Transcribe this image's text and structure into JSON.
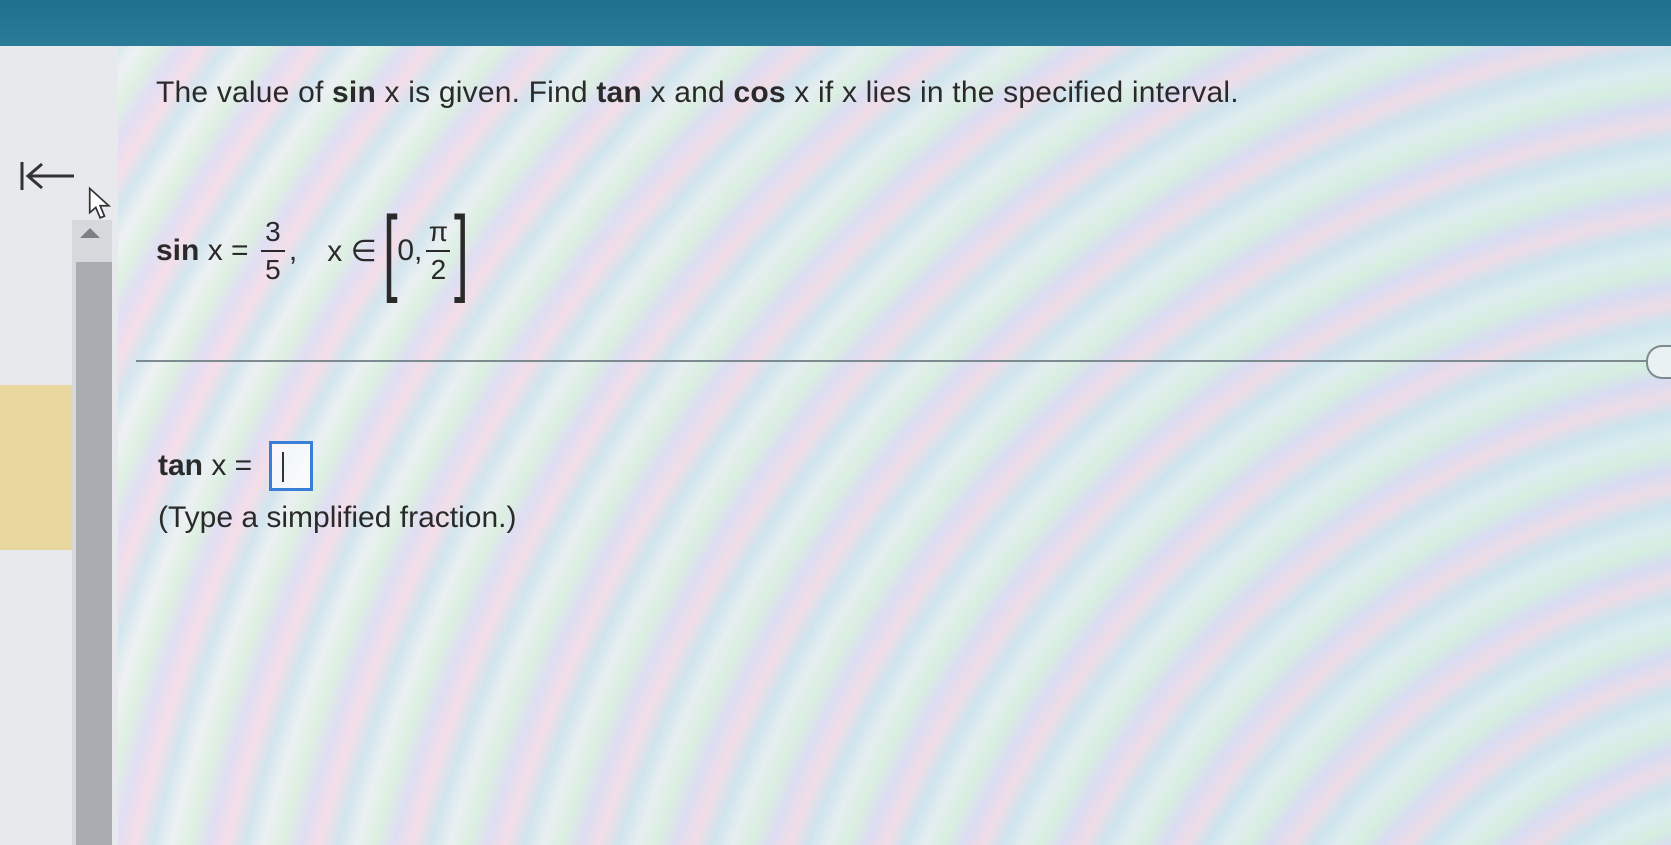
{
  "question": {
    "prefix": "The value of ",
    "fn1": "sin",
    "t1": " x is given. Find ",
    "fn2": "tan",
    "t2": " x and ",
    "fn3": "cos",
    "t3": " x if x lies in the specified interval."
  },
  "given": {
    "fn": "sin",
    "var_eq": " x = ",
    "num": "3",
    "den": "5",
    "comma": ",",
    "in": "x ∈",
    "open_bracket": "[",
    "lower": "0,",
    "pi_num": "π",
    "pi_den": "2",
    "close_bracket": "]"
  },
  "answer": {
    "fn": "tan",
    "var_eq": " x = ",
    "value": ""
  },
  "hint": "(Type a simplified fraction.)",
  "icons": {
    "back": "back-to-start-icon",
    "cursor": "mouse-pointer-icon",
    "scroll_up": "scroll-up-arrow-icon"
  },
  "colors": {
    "top_bar": "#1f6f8f",
    "input_border": "#3b7ed8",
    "highlight": "#e8d8a0"
  }
}
